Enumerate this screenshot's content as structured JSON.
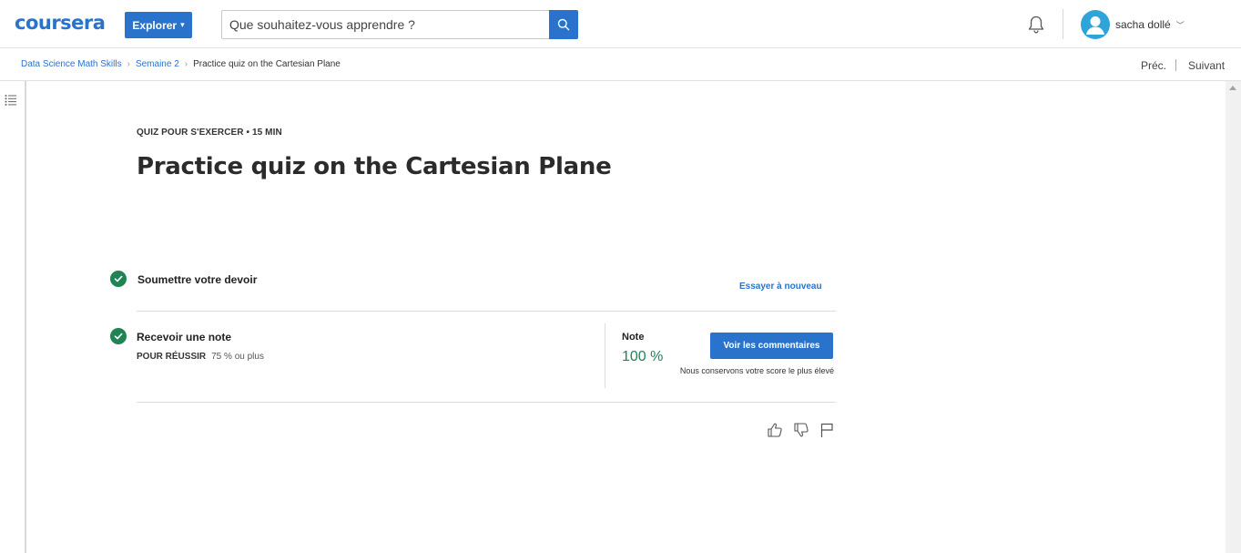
{
  "header": {
    "logo": "coursera",
    "explore_label": "Explorer",
    "search_placeholder": "Que souhaitez-vous apprendre ?",
    "user_name": "sacha dollé"
  },
  "breadcrumb": {
    "items": [
      "Data Science Math Skills",
      "Semaine 2"
    ],
    "current": "Practice quiz on the Cartesian Plane",
    "prev_label": "Préc.",
    "next_label": "Suivant"
  },
  "quiz": {
    "eyebrow": "QUIZ POUR S'EXERCER • 15  MIN",
    "title": "Practice quiz on the Cartesian Plane",
    "submit_step": "Soumettre votre devoir",
    "retry_label": "Essayer à nouveau",
    "grade_step": "Recevoir une note",
    "pass_label": "POUR RÉUSSIR",
    "pass_value": "75 % ou plus",
    "grade_label": "Note",
    "grade_value": "100 %",
    "feedback_button": "Voir les commentaires",
    "keep_note": "Nous conservons votre score le plus élevé"
  },
  "colors": {
    "accent": "#2a73cc",
    "success": "#1f8354"
  },
  "icons": {
    "search": "search-icon",
    "bell": "bell-icon",
    "avatar": "user-avatar-icon",
    "outline": "list-outline-icon",
    "check": "check-circle-icon",
    "like": "thumbs-up-icon",
    "dislike": "thumbs-down-icon",
    "flag": "flag-icon"
  }
}
